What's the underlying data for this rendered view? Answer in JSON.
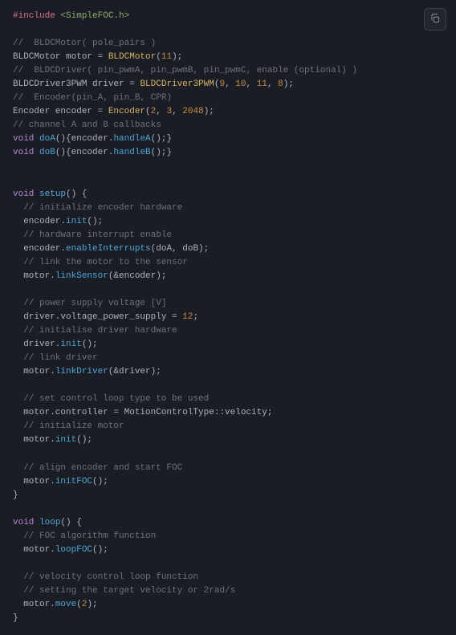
{
  "include": "#include",
  "header": "<SimpleFOC.h>",
  "c1": "//  BLDCMotor( pole_pairs )",
  "l2a": "BLDCMotor motor = ",
  "l2b": "BLDCMotor",
  "l2c": "(",
  "l2d": "11",
  "l2e": ");",
  "c3": "//  BLDCDriver( pin_pwmA, pin_pwmB, pin_pwmC, enable (optional) )",
  "l4a": "BLDCDriver3PWM driver = ",
  "l4b": "BLDCDriver3PWM",
  "l4c": "(",
  "l4d": "9",
  "l4e": ", ",
  "l4f": "10",
  "l4g": ", ",
  "l4h": "11",
  "l4i": ", ",
  "l4j": "8",
  "l4k": ");",
  "c5": "//  Encoder(pin_A, pin_B, CPR)",
  "l6a": "Encoder encoder = ",
  "l6b": "Encoder",
  "l6c": "(",
  "l6d": "2",
  "l6e": ", ",
  "l6f": "3",
  "l6g": ", ",
  "l6h": "2048",
  "l6i": ");",
  "c7": "// channel A and B callbacks",
  "l8a": "void",
  "l8b": " ",
  "l8c": "doA",
  "l8d": "(){encoder.",
  "l8e": "handleA",
  "l8f": "();}",
  "l9a": "void",
  "l9b": " ",
  "l9c": "doB",
  "l9d": "(){encoder.",
  "l9e": "handleB",
  "l9f": "();}",
  "l10a": "void",
  "l10b": " ",
  "l10c": "setup",
  "l10d": "() {",
  "c11": "  // initialize encoder hardware",
  "l12a": "  encoder.",
  "l12b": "init",
  "l12c": "();",
  "c13": "  // hardware interrupt enable",
  "l14a": "  encoder.",
  "l14b": "enableInterrupts",
  "l14c": "(doA, doB);",
  "c15": "  // link the motor to the sensor",
  "l16a": "  motor.",
  "l16b": "linkSensor",
  "l16c": "(&encoder);",
  "c17": "  // power supply voltage [V]",
  "l18a": "  driver.voltage_power_supply = ",
  "l18b": "12",
  "l18c": ";",
  "c19": "  // initialise driver hardware",
  "l20a": "  driver.",
  "l20b": "init",
  "l20c": "();",
  "c21": "  // link driver",
  "l22a": "  motor.",
  "l22b": "linkDriver",
  "l22c": "(&driver);",
  "c23": "  // set control loop type to be used",
  "l24": "  motor.controller = MotionControlType::velocity;",
  "c25": "  // initialize motor",
  "l26a": "  motor.",
  "l26b": "init",
  "l26c": "();",
  "c27": "  // align encoder and start FOC",
  "l28a": "  motor.",
  "l28b": "initFOC",
  "l28c": "();",
  "l29": "}",
  "l30a": "void",
  "l30b": " ",
  "l30c": "loop",
  "l30d": "() {",
  "c31": "  // FOC algorithm function",
  "l32a": "  motor.",
  "l32b": "loopFOC",
  "l32c": "();",
  "c33": "  // velocity control loop function",
  "c34": "  // setting the target velocity or 2rad/s",
  "l35a": "  motor.",
  "l35b": "move",
  "l35c": "(",
  "l35d": "2",
  "l35e": ");",
  "l36": "}"
}
